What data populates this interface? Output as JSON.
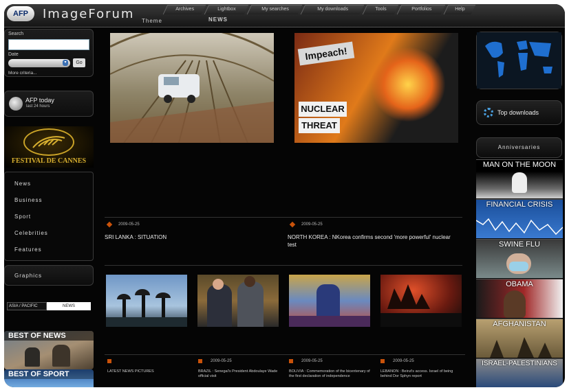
{
  "app": {
    "logo_text": "AFP",
    "title": "ImageForum"
  },
  "nav": {
    "tabs": [
      "Archives",
      "Lightbox",
      "My searches",
      "My downloads",
      "Tools",
      "Portfolios",
      "Help"
    ],
    "sub_left": "Theme",
    "sub_right": "NEWS"
  },
  "sidebar": {
    "search_label": "Search",
    "search_value": "",
    "date_label": "Date",
    "go_label": "Go",
    "more_criteria": "More criteria...",
    "afp_today_title": "AFP today",
    "afp_today_sub": "last 24 hours",
    "cannes_label": "FESTIVAL DE CANNES",
    "menu": [
      "News",
      "Business",
      "Sport",
      "Celebrities",
      "Features"
    ],
    "graphics": "Graphics",
    "lang_region": "ASIA / PACIFIC",
    "lang_section": "NEWS",
    "best_news": "BEST OF NEWS",
    "best_sport": "BEST OF SPORT"
  },
  "main": {
    "headlines": [
      {
        "date": "2009-05-25",
        "title": "SRI LANKA : SITUATION"
      },
      {
        "date": "2009-05-25",
        "title": "NORTH KOREA : NKorea confirms second 'more powerful' nuclear test"
      }
    ],
    "hero_texts": {
      "sign1": "Impeach!",
      "sign2": "NUCLEAR",
      "sign3": "THREAT"
    },
    "thumbs": [
      {
        "date": "",
        "caption": "LATEST NEWS PICTURES"
      },
      {
        "date": "2009-05-25",
        "caption": "BRAZIL : Senegal's President Abdoulaye Wade official visit"
      },
      {
        "date": "2009-05-25",
        "caption": "BOLIVIA : Commemoration of the bicentenary of the first declaration of independence"
      },
      {
        "date": "2009-05-25",
        "caption": "LEBANON : Beirut's access. Israel of being behind Dor Sphyn report"
      }
    ]
  },
  "right": {
    "top_downloads": "Top downloads",
    "anniversaries": "Anniversaries",
    "items": [
      "MAN ON THE MOON",
      "FINANCIAL CRISIS",
      "SWINE FLU",
      "OBAMA",
      "AFGHANISTAN",
      "ISRAEL-PALESTINIANS"
    ]
  },
  "colors": {
    "background": "#050505",
    "accent": "#c9520a",
    "panel": "#1a1a1a"
  }
}
